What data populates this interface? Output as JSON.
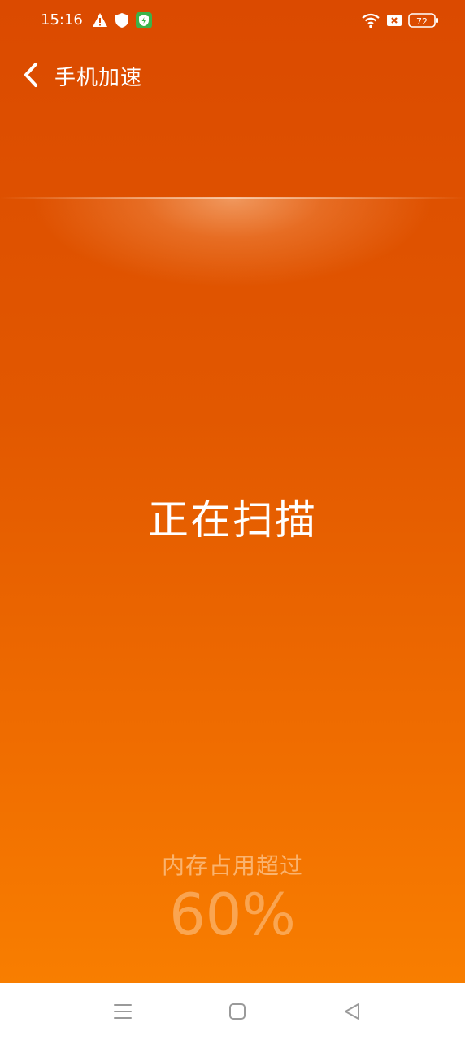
{
  "status_bar": {
    "time": "15:16",
    "battery_level": "72",
    "icons": [
      "warning-icon",
      "shield-icon",
      "security-app-icon",
      "wifi-icon",
      "sim-disabled-icon",
      "battery-icon"
    ]
  },
  "header": {
    "title": "手机加速",
    "back_icon": "chevron-left-icon"
  },
  "main": {
    "status_text": "正在扫描",
    "memory_caption": "内存占用超过",
    "memory_value": "60%"
  },
  "nav_bar": {
    "icons": [
      "menu-icon",
      "home-square-icon",
      "back-triangle-icon"
    ]
  },
  "colors": {
    "background_top": "#db4a00",
    "background_bottom": "#fa8200",
    "nav_bar": "#ffffff",
    "security_icon_green": "#3cb34a"
  }
}
